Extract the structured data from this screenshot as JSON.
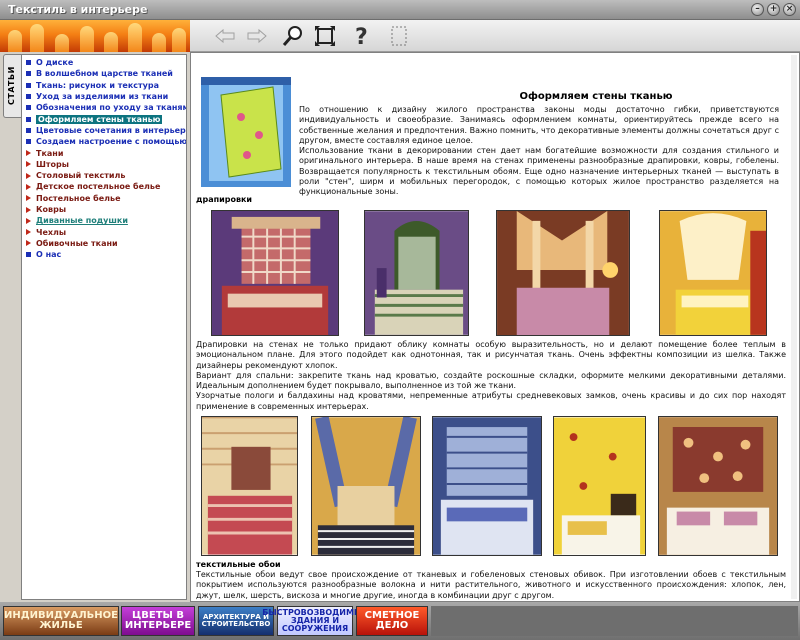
{
  "window": {
    "title": "Текстиль в интерьере",
    "buttons": [
      "minimize",
      "maximize",
      "close"
    ]
  },
  "toolbar": {
    "icons": [
      "back-arrow-icon",
      "forward-arrow-icon",
      "magnifier-icon",
      "fullscreen-icon",
      "help-icon",
      "select-icon"
    ]
  },
  "sidebar": {
    "tab_label": "СТАТЬИ",
    "items": [
      {
        "label": "О диске",
        "marker": "square",
        "style": "normal"
      },
      {
        "label": "В волшебном царстве тканей",
        "marker": "square",
        "style": "normal"
      },
      {
        "label": "Ткань: рисунок и текстура",
        "marker": "square",
        "style": "normal"
      },
      {
        "label": "Уход за изделиями из ткани",
        "marker": "square",
        "style": "normal"
      },
      {
        "label": "Обозначения по уходу за тканями",
        "marker": "square",
        "style": "normal"
      },
      {
        "label": "Оформляем стены тканью",
        "marker": "square",
        "style": "active"
      },
      {
        "label": "Цветовые сочетания в интерьере",
        "marker": "square",
        "style": "normal"
      },
      {
        "label": "Создаем настроение с помощью цв",
        "marker": "square",
        "style": "normal"
      },
      {
        "label": "Ткани",
        "marker": "triangle",
        "style": "normal"
      },
      {
        "label": "Шторы",
        "marker": "triangle",
        "style": "normal"
      },
      {
        "label": "Столовый текстиль",
        "marker": "triangle",
        "style": "normal"
      },
      {
        "label": "Детское постельное белье",
        "marker": "triangle",
        "style": "normal"
      },
      {
        "label": "Постельное белье",
        "marker": "triangle",
        "style": "normal"
      },
      {
        "label": "Ковры",
        "marker": "triangle",
        "style": "normal"
      },
      {
        "label": "Диванные подушки",
        "marker": "triangle",
        "style": "link"
      },
      {
        "label": "Чехлы",
        "marker": "triangle",
        "style": "normal"
      },
      {
        "label": "Обивочные ткани",
        "marker": "triangle",
        "style": "normal"
      },
      {
        "label": "О нас",
        "marker": "square",
        "style": "normal"
      }
    ]
  },
  "article": {
    "title": "Оформляем стены тканью",
    "intro": "По отношению к дизайну жилого пространства законы моды достаточно гибки, приветствуются индивидуальность и своеобразие. Занимаясь оформлением комнаты, ориентируйтесь прежде всего на собственные желания и предпочтения. Важно помнить, что декоративные элементы должны сочетаться друг с другом, вместе составляя единое целое.\nИспользование ткани в декорировании стен дает нам богатейшие возможности для создания стильного и оригинального интерьера. В наше время на стенах применены разнообразные драпировки, ковры, гобелены. Возвращается популярность к текстильным обоям. Еще одно назначение интерьерных тканей — выступать в роли \"стен\", ширм и мобильных перегородок, с помощью которых жилое пространство разделяется на функциональные зоны.",
    "section1_heading": "драпировки",
    "section1_text": "Драпировки на стенах не только придают облику комнаты особую выразительность, но и делают помещение более теплым в эмоциональном плане. Для этого подойдет как однотонная, так и рисунчатая ткань. Очень эффектны композиции из шелка. Также дизайнеры рекомендуют хлопок.\nВариант для спальни: закрепите ткань над кроватью, создайте роскошные складки, оформите мелкими декоративными деталями. Идеальным дополнением будет покрывало, выполненное из той же ткани.\nУзорчатые пологи и балдахины над кроватями, непременные атрибуты средневековых замков, очень красивы и до сих пор находят применение в современных интерьерах.",
    "section2_heading": "текстильные обои",
    "section2_text": "Текстильные обои ведут свое происхождение от тканевых и гобеленовых стеновых обивок. При изготовлении обоев с текстильным покрытием используются разнообразные волокна и нити растительного, животного и искусственного происхождения: хлопок, лен, джут, шелк, шерсть, вискоза и многие другие, иногда в комбинации друг с другом."
  },
  "bottom_links": [
    {
      "label": "ИНДИВИДУАЛЬНОЕ ЖИЛЬЕ"
    },
    {
      "label": "ЦВЕТЫ В ИНТЕРЬЕРЕ"
    },
    {
      "label": "АРХИТЕКТУРА И СТРОИТЕЛЬСТВО"
    },
    {
      "label": "БЫСТРОВОЗВОДИМЫЕ ЗДАНИЯ И СООРУЖЕНИЯ"
    },
    {
      "label": "СМЕТНОЕ ДЕЛО"
    }
  ],
  "colors": {
    "nav_text": "#7a1a12",
    "nav_blue": "#1b2fb5",
    "nav_active_bg": "#0d7480",
    "banner_orange": "#f47f14"
  }
}
